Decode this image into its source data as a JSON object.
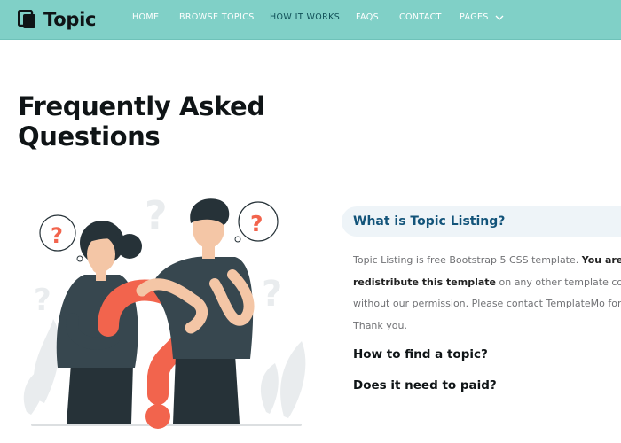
{
  "brand": {
    "name": "Topic"
  },
  "nav": {
    "items": [
      {
        "label": "HOME"
      },
      {
        "label": "BROWSE TOPICS"
      },
      {
        "label": "HOW IT WORKS"
      },
      {
        "label": "FAQS"
      },
      {
        "label": "CONTACT"
      },
      {
        "label": "PAGES"
      }
    ],
    "active_index": 2
  },
  "page": {
    "title_line1": "Frequently Asked",
    "title_line2": "Questions"
  },
  "faq": {
    "open": {
      "question": "What is Topic Listing?",
      "answer_line1_plain": "Topic Listing is free Bootstrap 5 CSS template. ",
      "answer_line1_bold": "You are not allowed to",
      "answer_line2_bold": "redistribute this template",
      "answer_line2_plain": " on any other template collection website",
      "answer_line3": "without our permission. Please contact TemplateMo for more information.",
      "answer_line4": "Thank you."
    },
    "questions": [
      {
        "question": "How to find a topic?"
      },
      {
        "question": "Does it need to paid?"
      }
    ]
  },
  "colors": {
    "navbar": "#80d0c7",
    "accent_dark": "#13547a",
    "illustration_red": "#f2644d",
    "illustration_dark": "#263238"
  },
  "icons": {
    "brand": "book-icon",
    "dropdown": "chevron-down-icon"
  }
}
